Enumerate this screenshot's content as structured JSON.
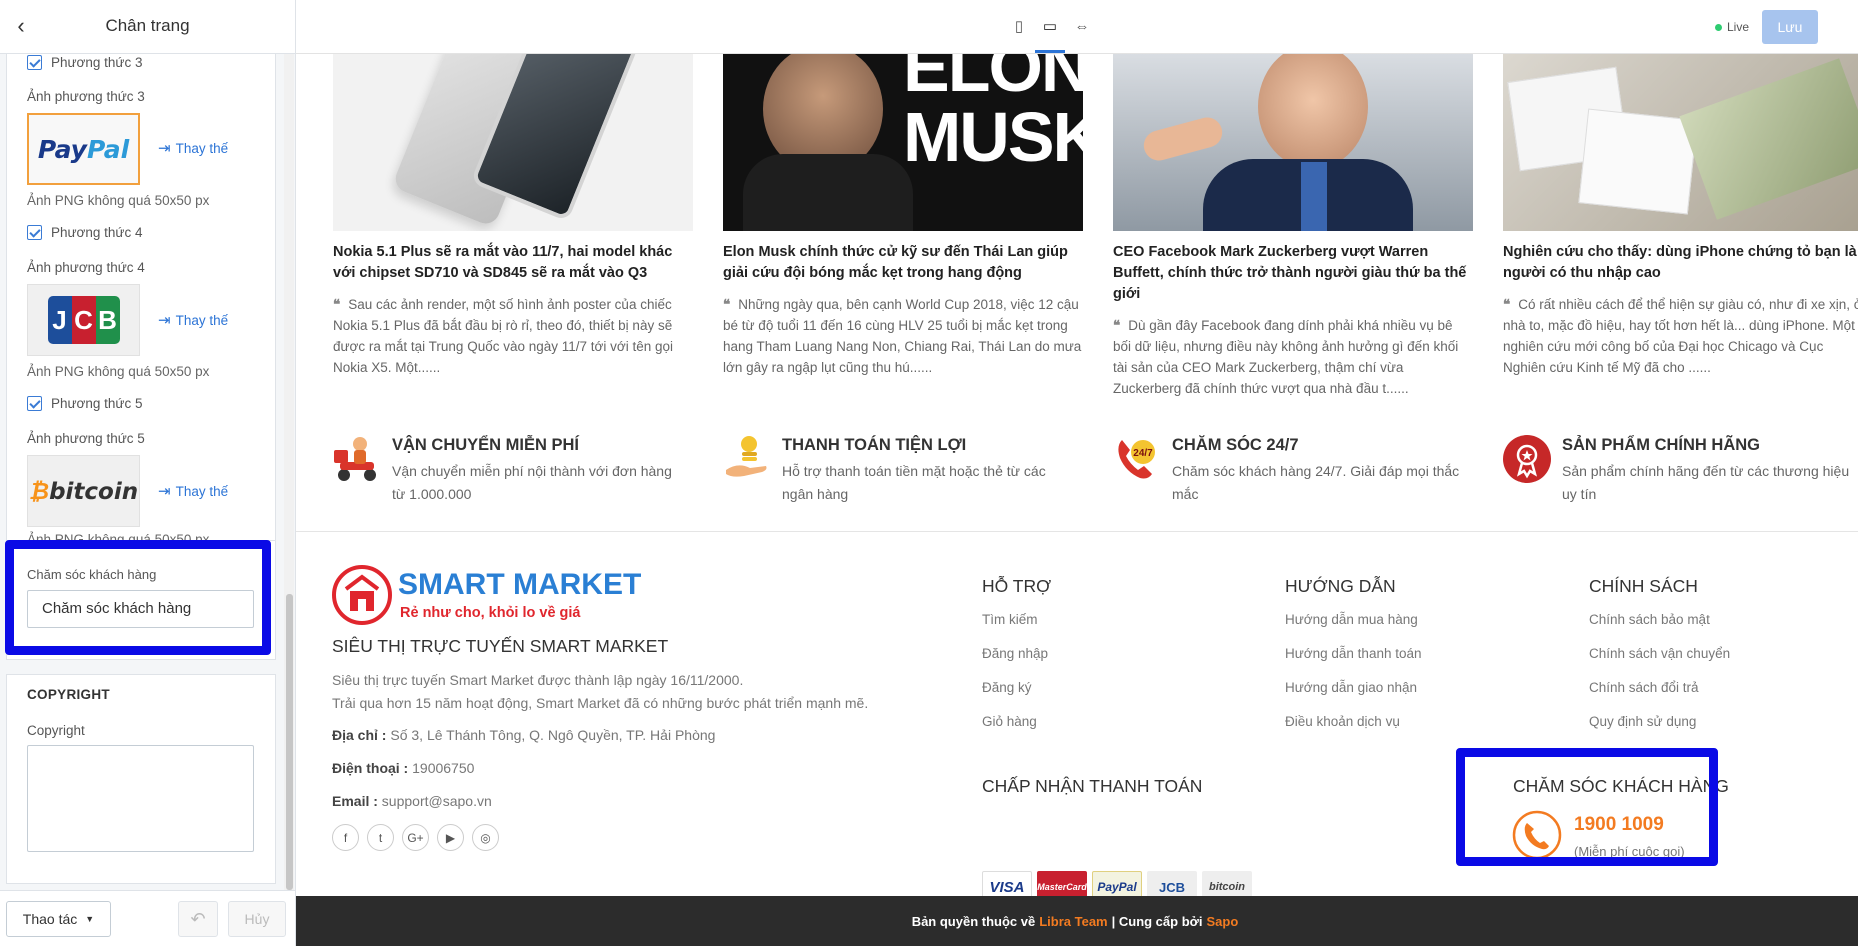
{
  "sidebar": {
    "title": "Chân trang",
    "methods": [
      {
        "check_label": "Phương thức 3",
        "image_label": "Ảnh phương thức 3",
        "logo": "PayPal",
        "replace_label": "Thay thế",
        "hint": "Ảnh PNG không quá 50x50 px"
      },
      {
        "check_label": "Phương thức 4",
        "image_label": "Ảnh phương thức 4",
        "logo": "JCB",
        "replace_label": "Thay thế",
        "hint": "Ảnh PNG không quá 50x50 px"
      },
      {
        "check_label": "Phương thức 5",
        "image_label": "Ảnh phương thức 5",
        "logo": "bitcoin",
        "replace_label": "Thay thế",
        "hint": "Ảnh PNG không quá 50x50 px"
      }
    ],
    "support_field": {
      "label": "Chăm sóc khách hàng",
      "value": "Chăm sóc khách hàng"
    },
    "copyright": {
      "heading": "COPYRIGHT",
      "label": "Copyright",
      "value": ""
    },
    "footer_actions": {
      "actions_label": "Thao tác",
      "cancel_label": "Hủy"
    }
  },
  "topbar": {
    "live_label": "Live",
    "save_label": "Lưu"
  },
  "news": [
    {
      "title": "Nokia 5.1 Plus sẽ ra mắt vào 11/7, hai model khác với chipset SD710 và SD845 sẽ ra mắt vào Q3",
      "excerpt": "Sau các ảnh render, một số hình ảnh poster của chiếc Nokia 5.1 Plus đã bắt đầu bị rò rỉ, theo đó, thiết bị này sẽ được ra mắt tại Trung Quốc vào ngày 11/7 tới với tên gọi Nokia X5.  Một......"
    },
    {
      "title": "Elon Musk chính thức cử kỹ sư đến Thái Lan giúp giải cứu đội bóng mắc kẹt trong hang động",
      "excerpt": "Những ngày qua, bên cạnh World Cup 2018, việc 12 cậu bé từ độ tuổi 11 đến 16 cùng HLV 25 tuổi bị mắc kẹt trong hang Tham Luang Nang Non, Chiang Rai, Thái Lan do mưa lớn gây ra ngập lụt cũng thu hú......"
    },
    {
      "title": "CEO Facebook Mark Zuckerberg vượt Warren Buffett, chính thức trở thành người giàu thứ ba thế giới",
      "excerpt": "Dù gần đây Facebook đang dính phải khá nhiều vụ bê bối dữ liệu, nhưng điều này không ảnh hưởng gì đến khối tài sản của CEO Mark Zuckerberg, thậm chí vừa Zuckerberg đã chính thức vượt qua nhà đầu t......"
    },
    {
      "title": "Nghiên cứu cho thấy: dùng iPhone chứng tỏ bạn là người có thu nhập cao",
      "excerpt": "Có rất nhiều cách để thể hiện sự giàu có, như đi xe xịn, ở nhà to, mặc đồ hiệu, hay tốt hơn hết là... dùng iPhone. Một nghiên cứu mới công bố của Đại học Chicago và Cục Nghiên cứu Kinh tế Mỹ đã cho ......"
    }
  ],
  "elon_image_text": [
    "ELON",
    "MUSK"
  ],
  "features": [
    {
      "title": "VẬN CHUYỂN MIỄN PHÍ",
      "text": "Vận chuyển miễn phí nội thành với đơn hàng từ 1.000.000"
    },
    {
      "title": "THANH TOÁN TIỆN LỢI",
      "text": "Hỗ trợ thanh toán tiền mặt hoặc thẻ từ các ngân hàng"
    },
    {
      "title": "CHĂM SÓC 24/7",
      "text": "Chăm sóc khách hàng 24/7. Giải đáp mọi thắc mắc",
      "badge": "24/7"
    },
    {
      "title": "SẢN PHẨM CHÍNH HÃNG",
      "text": "Sản phẩm chính hãng đến từ các thương hiệu uy tín"
    }
  ],
  "footer": {
    "brand": "SMART MARKET",
    "slogan": "Rẻ như cho, khỏi lo về giá",
    "store_title": "SIÊU THỊ TRỰC TUYẾN SMART MARKET",
    "about_line1": "Siêu thị trực tuyến Smart Market được thành lập ngày 16/11/2000.",
    "about_line2": "Trải qua hơn 15 năm hoạt động, Smart Market đã có những bước phát triển mạnh mẽ.",
    "address_label": "Địa chỉ :",
    "address": "Số 3, Lê Thánh Tông, Q. Ngô Quyền, TP. Hải Phòng",
    "phone_label": "Điện thoại :",
    "phone": "19006750",
    "email_label": "Email :",
    "email": "support@sapo.vn",
    "social_icons": [
      "facebook-icon",
      "twitter-icon",
      "google-plus-icon",
      "youtube-icon",
      "instagram-icon"
    ],
    "columns": [
      {
        "heading": "HỖ TRỢ",
        "links": [
          "Tìm kiếm",
          "Đăng nhập",
          "Đăng ký",
          "Giỏ hàng"
        ]
      },
      {
        "heading": "HƯỚNG DẪN",
        "links": [
          "Hướng dẫn mua hàng",
          "Hướng dẫn thanh toán",
          "Hướng dẫn giao nhận",
          "Điều khoản dịch vụ"
        ]
      },
      {
        "heading": "CHÍNH SÁCH",
        "links": [
          "Chính sách bảo mật",
          "Chính sách vận chuyển",
          "Chính sách đổi trả",
          "Quy định sử dụng"
        ]
      }
    ],
    "payment_heading": "CHẤP NHẬN THANH TOÁN",
    "payment_methods": [
      "VISA",
      "MasterCard",
      "PayPal",
      "JCB",
      "bitcoin"
    ],
    "support_heading": "CHĂM SÓC KHÁCH HÀNG",
    "hotline": "1900 1009",
    "hotline_note": "(Miễn phí cuộc gọi)"
  },
  "copyright_bar": {
    "prefix": "Bản quyền thuộc về",
    "team": "Libra Team",
    "sep": "| Cung cấp bởi",
    "provider": "Sapo"
  },
  "colors": {
    "accent": "#2c74d6",
    "highlight_frame": "#0a0ae6",
    "brand_red": "#e0262d",
    "brand_blue": "#2a7fd4",
    "orange": "#f37b21"
  }
}
